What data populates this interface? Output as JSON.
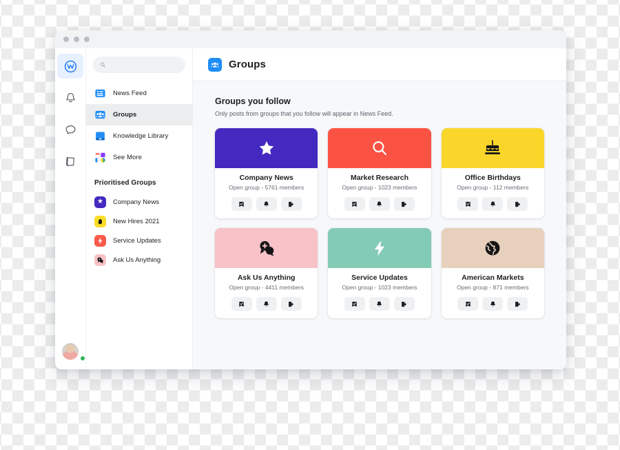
{
  "window": {
    "traffic_lights": [
      "close",
      "minimize",
      "maximize"
    ]
  },
  "rail": {
    "items": [
      {
        "name": "workplace-home",
        "icon": "workplace-logo-icon",
        "active": true
      },
      {
        "name": "notifications",
        "icon": "bell-icon",
        "active": false
      },
      {
        "name": "chat",
        "icon": "chat-bubble-icon",
        "active": false
      },
      {
        "name": "knowledge",
        "icon": "book-icon",
        "active": false
      }
    ],
    "avatar": {
      "icon": "avatar",
      "status": "online"
    }
  },
  "sidebar": {
    "search": {
      "placeholder": "",
      "value": "",
      "icon": "search-icon"
    },
    "nav": [
      {
        "label": "News Feed",
        "icon": "news-feed-icon",
        "active": false
      },
      {
        "label": "Groups",
        "icon": "groups-icon",
        "active": true
      },
      {
        "label": "Knowledge Library",
        "icon": "knowledge-library-icon",
        "active": false
      },
      {
        "label": "See More",
        "icon": "see-more-grid-icon",
        "active": false
      }
    ],
    "prioritised_title": "Prioritised Groups",
    "prioritised": [
      {
        "label": "Company News",
        "glyph": "★",
        "bg": "#4329c0",
        "fg": "#ffffff"
      },
      {
        "label": "New Hires 2021",
        "glyph": "✋",
        "bg": "#f9dd26",
        "fg": "#1c1e21"
      },
      {
        "label": "Service Updates",
        "glyph": "⚡",
        "bg": "#f85a49",
        "fg": "#ffffff"
      },
      {
        "label": "Ask Us Anything",
        "glyph": "💬",
        "bg": "#f7c3c6",
        "fg": "#1c1e21"
      }
    ]
  },
  "main": {
    "header": {
      "title": "Groups",
      "icon": "groups-icon"
    },
    "section": {
      "heading": "Groups you follow",
      "subheading": "Only posts from groups that you follow will appear in News Feed."
    },
    "action_labels": {
      "joined": "joined-icon",
      "notifications": "bell-icon",
      "leave": "leave-group-icon"
    },
    "cards": [
      {
        "name": "Company News",
        "meta": "Open group - 5761 members",
        "privacy": "Open group",
        "members": 5761,
        "cover_color": "#4329c0",
        "cover_icon": "star-icon",
        "glyph_color": "#ffffff"
      },
      {
        "name": "Market Research",
        "meta": "Open group - 1023 members",
        "privacy": "Open group",
        "members": 1023,
        "cover_color": "#fb5343",
        "cover_icon": "magnifier-icon",
        "glyph_color": "#ffffff"
      },
      {
        "name": "Office Birthdays",
        "meta": "Open group - 112 members",
        "privacy": "Open group",
        "members": 112,
        "cover_color": "#fad62a",
        "cover_icon": "birthday-cake-icon",
        "glyph_color": "#111111"
      },
      {
        "name": "Ask Us Anything",
        "meta": "Open group - 4411 members",
        "privacy": "Open group",
        "members": 4411,
        "cover_color": "#f8c2c8",
        "cover_icon": "question-bubbles-icon",
        "glyph_color": "#111111"
      },
      {
        "name": "Service Updates",
        "meta": "Open group - 1023 members",
        "privacy": "Open group",
        "members": 1023,
        "cover_color": "#84cbb6",
        "cover_icon": "lightning-bolt-icon",
        "glyph_color": "#ffffff"
      },
      {
        "name": "American Markets",
        "meta": "Open group - 871 members",
        "privacy": "Open group",
        "members": 871,
        "cover_color": "#e8d1bc",
        "cover_icon": "globe-icon",
        "glyph_color": "#111111"
      }
    ]
  }
}
